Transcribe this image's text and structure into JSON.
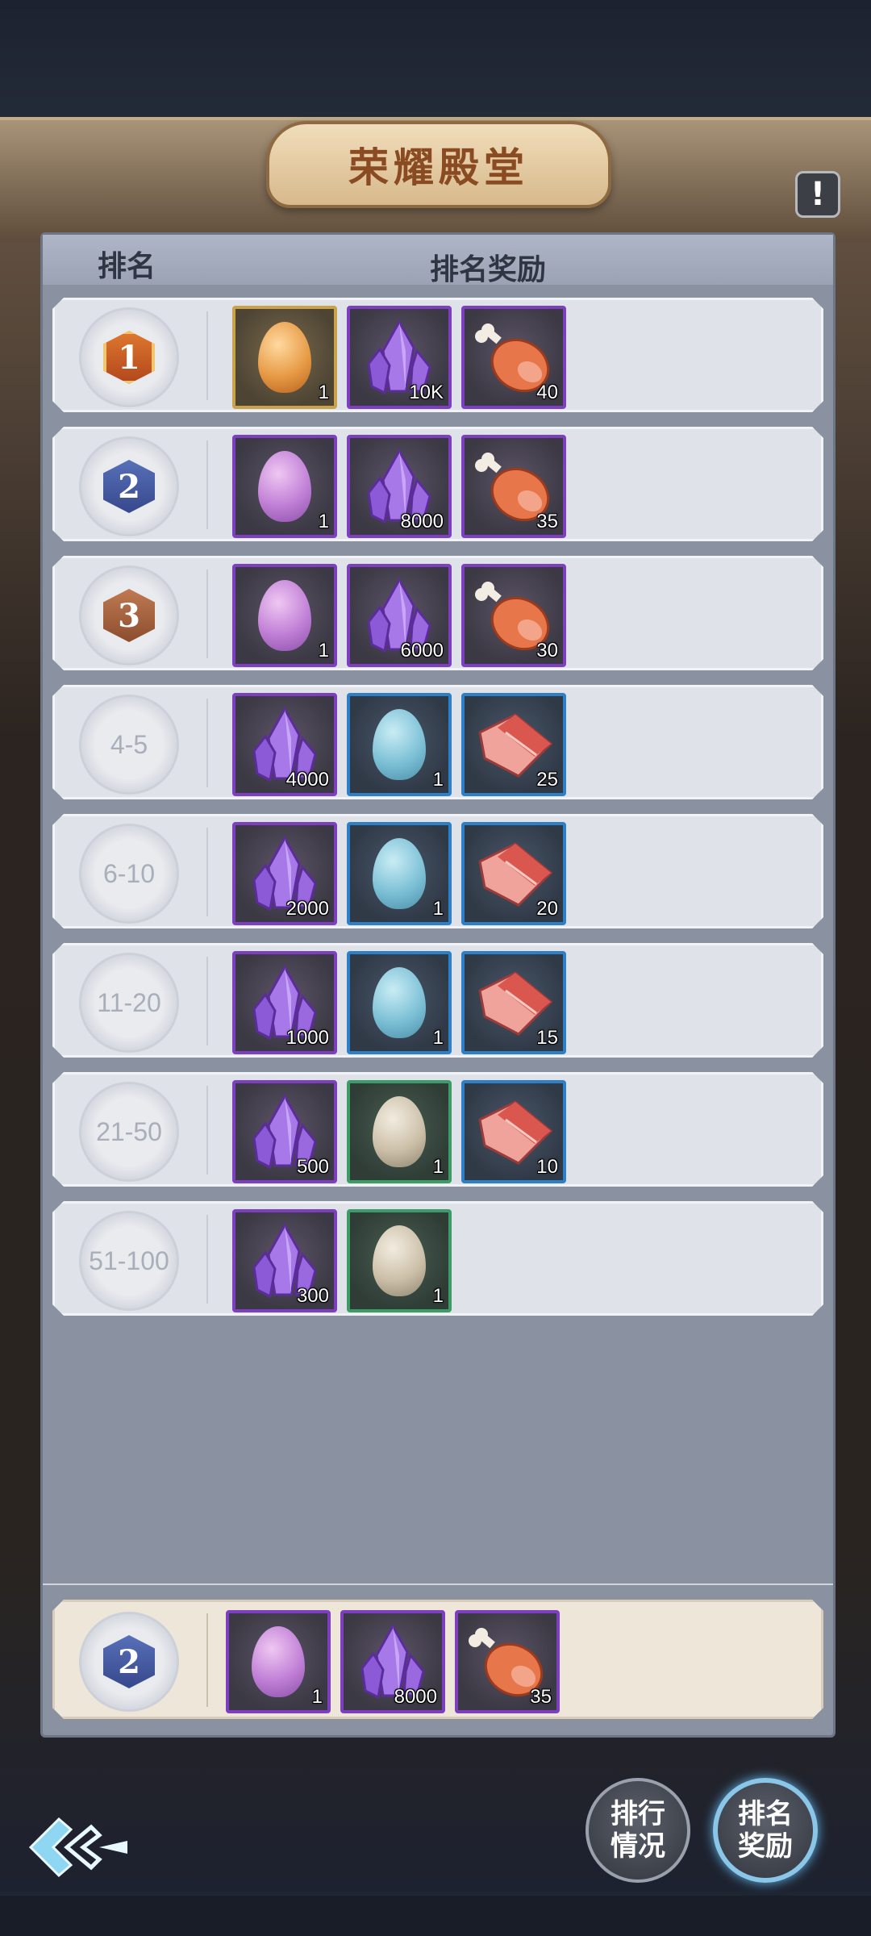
{
  "header": {
    "title": "荣耀殿堂",
    "info_label": "!"
  },
  "table": {
    "col_rank": "排名",
    "col_reward": "排名奖励"
  },
  "rows": [
    {
      "rank": "1",
      "badge": "gold",
      "items": [
        {
          "icon": "egg-orange-icon",
          "frame": "gold",
          "qty": "1"
        },
        {
          "icon": "crystal-icon",
          "frame": "purple",
          "qty": "10K"
        },
        {
          "icon": "meat-leg-icon",
          "frame": "purple",
          "qty": "40"
        }
      ]
    },
    {
      "rank": "2",
      "badge": "silver",
      "items": [
        {
          "icon": "egg-purple-icon",
          "frame": "purple",
          "qty": "1"
        },
        {
          "icon": "crystal-icon",
          "frame": "purple",
          "qty": "8000"
        },
        {
          "icon": "meat-leg-icon",
          "frame": "purple",
          "qty": "35"
        }
      ]
    },
    {
      "rank": "3",
      "badge": "bronze",
      "items": [
        {
          "icon": "egg-purple-icon",
          "frame": "purple",
          "qty": "1"
        },
        {
          "icon": "crystal-icon",
          "frame": "purple",
          "qty": "6000"
        },
        {
          "icon": "meat-leg-icon",
          "frame": "purple",
          "qty": "30"
        }
      ]
    },
    {
      "rank": "4-5",
      "badge": "",
      "items": [
        {
          "icon": "crystal-icon",
          "frame": "purple",
          "qty": "4000"
        },
        {
          "icon": "egg-blue-icon",
          "frame": "blue",
          "qty": "1"
        },
        {
          "icon": "meat-steak-icon",
          "frame": "blue",
          "qty": "25"
        }
      ]
    },
    {
      "rank": "6-10",
      "badge": "",
      "items": [
        {
          "icon": "crystal-icon",
          "frame": "purple",
          "qty": "2000"
        },
        {
          "icon": "egg-blue-icon",
          "frame": "blue",
          "qty": "1"
        },
        {
          "icon": "meat-steak-icon",
          "frame": "blue",
          "qty": "20"
        }
      ]
    },
    {
      "rank": "11-20",
      "badge": "",
      "items": [
        {
          "icon": "crystal-icon",
          "frame": "purple",
          "qty": "1000"
        },
        {
          "icon": "egg-blue-icon",
          "frame": "blue",
          "qty": "1"
        },
        {
          "icon": "meat-steak-icon",
          "frame": "blue",
          "qty": "15"
        }
      ]
    },
    {
      "rank": "21-50",
      "badge": "",
      "items": [
        {
          "icon": "crystal-icon",
          "frame": "purple",
          "qty": "500"
        },
        {
          "icon": "egg-white-icon",
          "frame": "green",
          "qty": "1"
        },
        {
          "icon": "meat-steak-icon",
          "frame": "blue",
          "qty": "10"
        }
      ]
    },
    {
      "rank": "51-100",
      "badge": "",
      "items": [
        {
          "icon": "crystal-icon",
          "frame": "purple",
          "qty": "300"
        },
        {
          "icon": "egg-white-icon",
          "frame": "green",
          "qty": "1"
        }
      ]
    }
  ],
  "my_rank": {
    "rank": "2",
    "badge": "silver",
    "items": [
      {
        "icon": "egg-purple-icon",
        "frame": "purple",
        "qty": "1"
      },
      {
        "icon": "crystal-icon",
        "frame": "purple",
        "qty": "8000"
      },
      {
        "icon": "meat-leg-icon",
        "frame": "purple",
        "qty": "35"
      }
    ]
  },
  "buttons": {
    "ranking_line1": "排行",
    "ranking_line2": "情况",
    "reward_line1": "排名",
    "reward_line2": "奖励"
  },
  "colors": {
    "purple_frame": "#7d3fc0",
    "blue_frame": "#2d7fc8",
    "green_frame": "#3d9b65",
    "gold_frame": "#c9a24a"
  }
}
